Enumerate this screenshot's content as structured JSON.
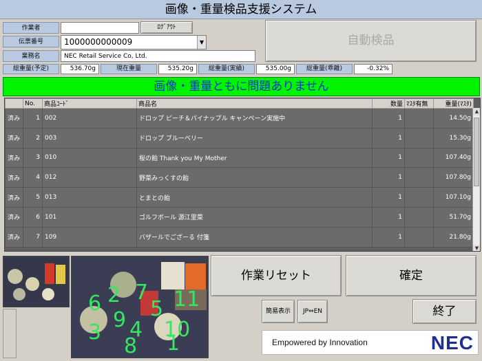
{
  "app": {
    "title": "画像・重量検品支援システム"
  },
  "header": {
    "worker_label": "作業者",
    "worker_value": "",
    "logout_label": "ﾛｸﾞｱｳﾄ",
    "slip_label": "伝票番号",
    "slip_value": "1000000000009",
    "company_label": "業務名",
    "company_value": "NEC Retail Service Co, Ltd.",
    "auto_inspect_label": "自動検品"
  },
  "weights": {
    "planned_label": "総重量(予定)",
    "planned_value": "536.70g",
    "current_label": "現在重量",
    "current_value": "535.20g",
    "actual_label": "総重量(実績)",
    "actual_value": "535.00g",
    "deviation_label": "総重量(乖離)",
    "deviation_value": "-0.32%"
  },
  "status_message": "画像・重量ともに問題ありません",
  "table": {
    "headers": [
      "",
      "No.",
      "商品ｺｰﾄﾞ",
      "商品名",
      "数量",
      "ﾏｽﾀ有無",
      "重量(ﾏｽﾀ)"
    ],
    "rows": [
      {
        "status": "済み",
        "no": "1",
        "code": "002",
        "name": "ドロップ ピーチ＆パイナップル キャンペーン実施中",
        "qty": "1",
        "master": "",
        "weight": "14.50g"
      },
      {
        "status": "済み",
        "no": "2",
        "code": "003",
        "name": "ドロップ ブルーベリー",
        "qty": "1",
        "master": "",
        "weight": "15.30g"
      },
      {
        "status": "済み",
        "no": "3",
        "code": "010",
        "name": "桜の飴 Thank you My Mother",
        "qty": "1",
        "master": "",
        "weight": "107.40g"
      },
      {
        "status": "済み",
        "no": "4",
        "code": "012",
        "name": "野菜みっくすの飴",
        "qty": "1",
        "master": "",
        "weight": "107.80g"
      },
      {
        "status": "済み",
        "no": "5",
        "code": "013",
        "name": "とまとの飴",
        "qty": "1",
        "master": "",
        "weight": "107.10g"
      },
      {
        "status": "済み",
        "no": "6",
        "code": "101",
        "name": "ゴルフボール 源江里菜",
        "qty": "1",
        "master": "",
        "weight": "51.70g"
      },
      {
        "status": "済み",
        "no": "7",
        "code": "109",
        "name": "バザールでござーる 付箋",
        "qty": "1",
        "master": "",
        "weight": "21.80g"
      }
    ]
  },
  "buttons": {
    "reset_label": "作業リセット",
    "confirm_label": "確定",
    "simple_label": "簡易表示",
    "lang_label": "JP⇔EN",
    "exit_label": "終了"
  },
  "camera_digits": [
    "6",
    "2",
    "7",
    "11",
    "5",
    "9",
    "3",
    "4",
    "10",
    "8",
    "1"
  ],
  "branding": {
    "tagline": "Empowered by Innovation",
    "logo": "NEC"
  }
}
